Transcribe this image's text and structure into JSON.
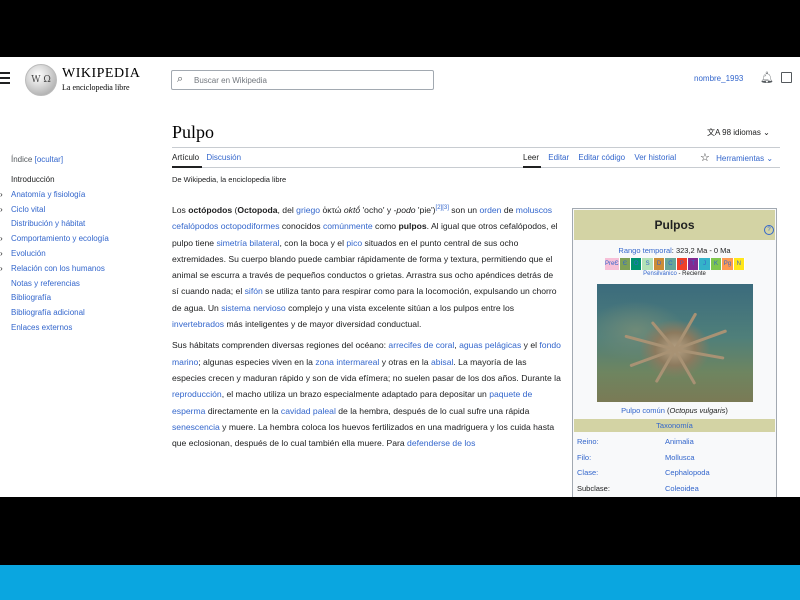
{
  "header": {
    "logo_title": "WIKIPEDIA",
    "logo_subtitle": "La enciclopedia libre",
    "search_placeholder": "Buscar en Wikipedia",
    "username": "nombre_1993"
  },
  "page": {
    "title": "Pulpo",
    "languages": "98 idiomas",
    "tabs": [
      "Artículo",
      "Discusión"
    ],
    "views": [
      "Leer",
      "Editar",
      "Editar código",
      "Ver historial"
    ],
    "tools": "Herramientas",
    "from": "De Wikipedia, la enciclopedia libre"
  },
  "toc": {
    "heading": "Índice",
    "hide": "[ocultar]",
    "items": [
      "Introducción",
      "Anatomía y fisiología",
      "Ciclo vital",
      "Distribución y hábitat",
      "Comportamiento y ecología",
      "Evolución",
      "Relación con los humanos",
      "Notas y referencias",
      "Bibliografía",
      "Bibliografía adicional",
      "Enlaces externos"
    ]
  },
  "article": {
    "p1": {
      "t1": "Los ",
      "b1": "octópodos",
      "t2": " (",
      "b2": "Octopoda",
      "t3": ", del ",
      "l1": "griego",
      "t4": " ὀκτώ ",
      "i1": "oktṓ",
      "t5": " 'ocho' y ",
      "i2": "-podo",
      "t6": " 'pie')",
      "sup": "[2][3]",
      "t7": " son un ",
      "l2": "orden",
      "t8": " de ",
      "l3": "moluscos cefalópodos octopodiformes",
      "t9": " conocidos ",
      "l4": "comúnmente",
      "t10": " como ",
      "b3": "pulpos",
      "t11": ". Al igual que otros cefalópodos, el pulpo tiene ",
      "l5": "simetría bilateral",
      "t12": ", con la boca y el ",
      "l6": "pico",
      "t13": " situados en el punto central de sus ocho extremidades. Su cuerpo blando puede cambiar rápidamente de forma y textura, permitiendo que el animal se escurra a través de pequeños conductos o grietas. Arrastra sus ocho apéndices detrás de sí cuando nada; el ",
      "l7": "sifón",
      "t14": " se utiliza tanto para respirar como para la locomoción, expulsando un chorro de agua. Un ",
      "l8": "sistema nervioso",
      "t15": " complejo y una vista excelente sitúan a los pulpos entre los ",
      "l9": "invertebrados",
      "t16": " más inteligentes y de mayor diversidad conductual."
    },
    "p2": {
      "t1": "Sus hábitats comprenden diversas regiones del océano: ",
      "l1": "arrecifes de coral",
      "t2": ", ",
      "l2": "aguas pelágicas",
      "t3": " y el ",
      "l3": "fondo marino",
      "t4": "; algunas especies viven en la ",
      "l4": "zona intermareal",
      "t5": " y otras en la ",
      "l5": "abisal",
      "t6": ". La mayoría de las especies crecen y maduran rápido y son de vida efímera; no suelen pasar de los dos años. Durante la ",
      "l6": "reproducción",
      "t7": ", el macho utiliza un brazo especialmente adaptado para depositar un ",
      "l7": "paquete de esperma",
      "t8": " directamente en la ",
      "l8": "cavidad paleal",
      "t9": " de la hembra, después de lo cual sufre una rápida ",
      "l9": "senescencia",
      "t10": " y muere. La hembra coloca los huevos fertilizados en una madriguera y los cuida hasta que eclosionan, después de lo cual también ella muere. Para ",
      "l10": "defenderse de los"
    }
  },
  "infobox": {
    "name": "Pulpos",
    "help": "?",
    "range_label": "Rango temporal",
    "range_value": ": 323,2 Ma - 0 Ma",
    "periods_bar": [
      "PreЄ",
      "Є",
      "O",
      "S",
      "D",
      "C",
      "P",
      "T",
      "J",
      "K",
      "Pg",
      "N"
    ],
    "periods_colors": [
      "#f7c0d8",
      "#7fa056",
      "#009270",
      "#b3e1b6",
      "#cb8c37",
      "#67a599",
      "#f04028",
      "#812b92",
      "#34b2c9",
      "#7fc64e",
      "#fd9a52",
      "#ffe619"
    ],
    "period_from": "Pensilvánico",
    "period_sep": " - ",
    "period_to": "Reciente",
    "caption_link": "Pulpo común",
    "caption_text1": " (",
    "caption_italic": "Octopus vulgaris",
    "caption_text2": ")",
    "taxonomy_label": "Taxonomía",
    "taxonomy": [
      {
        "rank": "Reino:",
        "value": "Animalia"
      },
      {
        "rank": "Filo:",
        "value": "Mollusca"
      },
      {
        "rank": "Clase:",
        "value": "Cephalopoda"
      },
      {
        "rank": "Subclase:",
        "value": "Coleoidea"
      }
    ]
  },
  "colors": {
    "link": "#3366cc",
    "infobox_header": "#d3d3a4",
    "taskbar": "#0aa6e0"
  }
}
